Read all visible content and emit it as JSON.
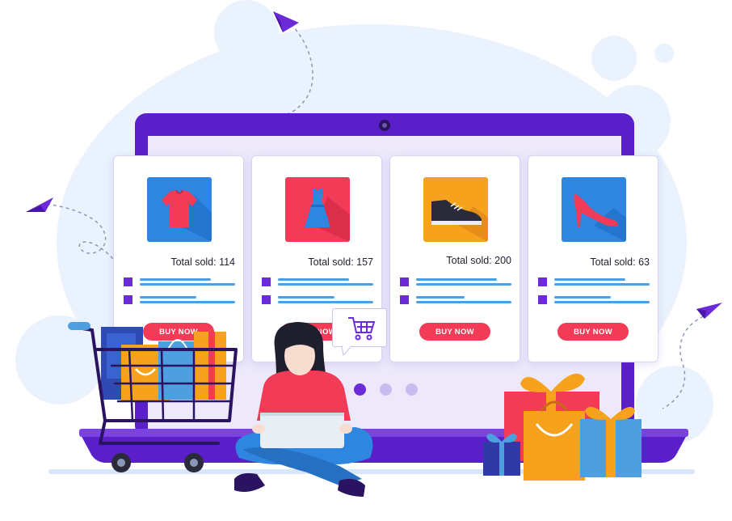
{
  "products": [
    {
      "name": "t-shirt",
      "sold_label": "Total sold: 114",
      "button_label": "BUY NOW",
      "tile_color": "#2f86e0"
    },
    {
      "name": "dress",
      "sold_label": "Total sold: 157",
      "button_label": "BUY NOW",
      "tile_color": "#f23b56"
    },
    {
      "name": "sneaker",
      "sold_label": "Total sold: 200",
      "button_label": "BUY NOW",
      "tile_color": "#f7a21d"
    },
    {
      "name": "high-heel",
      "sold_label": "Total sold: 63",
      "button_label": "BUY NOW",
      "tile_color": "#2f86e0"
    }
  ],
  "carousel": {
    "slides": 3,
    "active_index": 0
  },
  "colors": {
    "accent_purple": "#6b2bd9",
    "laptop_frame": "#5a1fc8",
    "button_red": "#f23b56",
    "blob_blue": "#e9f2fd",
    "spec_line": "#4d9fe0"
  },
  "icons": [
    "paper-plane-icon",
    "shopping-cart-icon",
    "gift-box-icon",
    "shopping-bag-icon",
    "webcam-icon"
  ]
}
